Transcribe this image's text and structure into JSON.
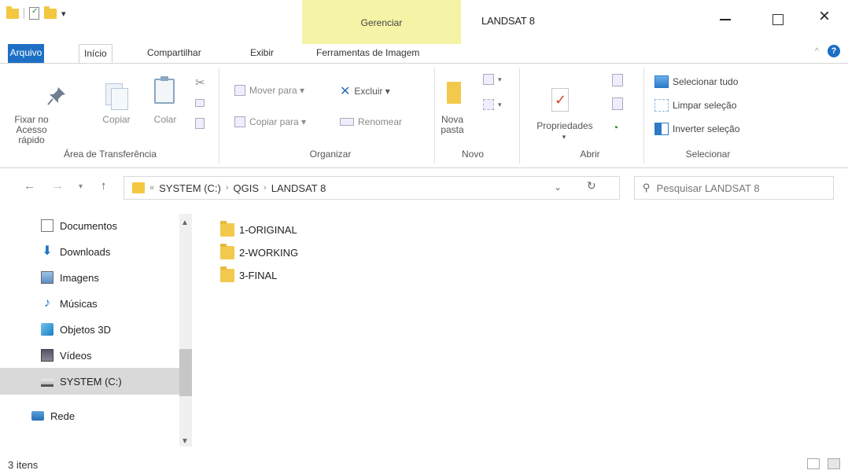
{
  "titlebar": {
    "window_title": "LANDSAT 8",
    "contextual_tab": "Gerenciar",
    "close_glyph": "×"
  },
  "tabs": [
    {
      "label": "Arquivo"
    },
    {
      "label": "Início"
    },
    {
      "label": "Compartilhar"
    },
    {
      "label": "Exibir"
    },
    {
      "label": "Ferramentas de Imagem"
    }
  ],
  "ribbon": {
    "clipboard": {
      "group": "Área de Transferência",
      "pin": "Fixar no\nAcesso rápido",
      "copy": "Copiar",
      "paste": "Colar"
    },
    "organize": {
      "group": "Organizar",
      "move_to": "Mover para ▾",
      "copy_to": "Copiar para ▾",
      "delete": "Excluir ▾",
      "rename": "Renomear"
    },
    "new": {
      "group": "Novo",
      "new_folder": "Nova\npasta"
    },
    "open": {
      "group": "Abrir",
      "properties": "Propriedades"
    },
    "select": {
      "group": "Selecionar",
      "select_all": "Selecionar tudo",
      "clear_selection": "Limpar seleção",
      "invert_selection": "Inverter seleção"
    }
  },
  "address": {
    "overflow": "«",
    "crumbs": [
      "SYSTEM (C:)",
      "QGIS",
      "LANDSAT 8"
    ],
    "search_placeholder": "Pesquisar LANDSAT 8"
  },
  "nav_pane": {
    "items": [
      {
        "label": "Documentos",
        "icon": "documents-icon"
      },
      {
        "label": "Downloads",
        "icon": "downloads-icon"
      },
      {
        "label": "Imagens",
        "icon": "pictures-icon"
      },
      {
        "label": "Músicas",
        "icon": "music-icon"
      },
      {
        "label": "Objetos 3D",
        "icon": "objects-3d-icon"
      },
      {
        "label": "Vídeos",
        "icon": "videos-icon"
      },
      {
        "label": "SYSTEM (C:)",
        "icon": "drive-icon",
        "selected": true
      },
      {
        "label": "Rede",
        "icon": "network-icon"
      }
    ]
  },
  "files": [
    {
      "name": "1-ORIGINAL",
      "type": "folder"
    },
    {
      "name": "2-WORKING",
      "type": "folder"
    },
    {
      "name": "3-FINAL",
      "type": "folder"
    }
  ],
  "status": {
    "item_count": "3 itens"
  },
  "colors": {
    "file_tab": "#1d6fc4",
    "manage_tab": "#f5f3a5",
    "selection": "#d9d9d9",
    "folder": "#f2c94c"
  }
}
